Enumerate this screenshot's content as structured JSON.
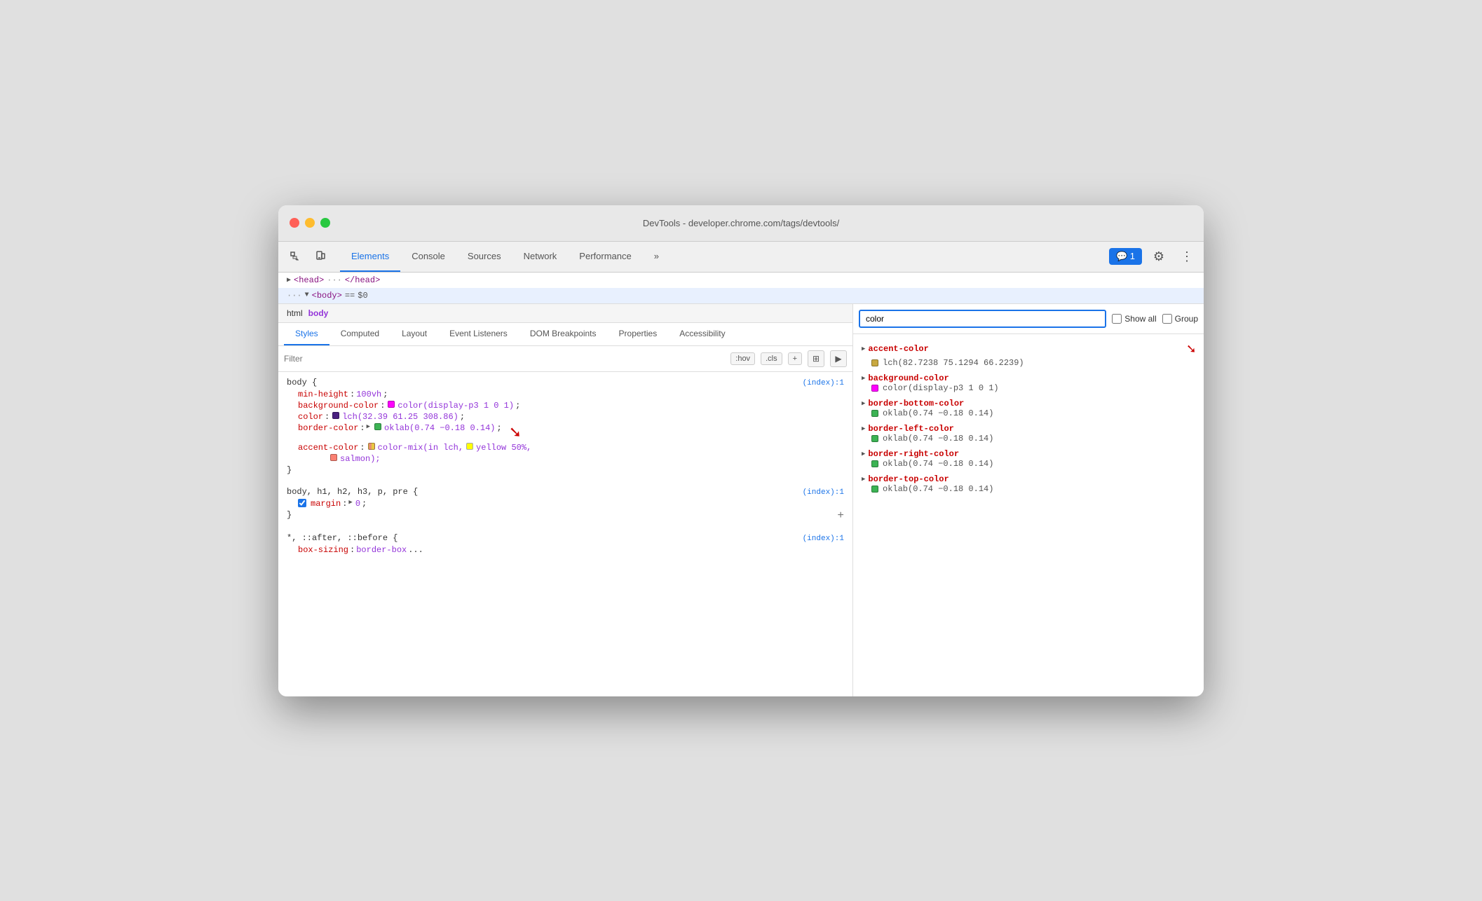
{
  "window": {
    "title": "DevTools - developer.chrome.com/tags/devtools/"
  },
  "toolbar": {
    "tabs": [
      {
        "label": "Elements",
        "active": true
      },
      {
        "label": "Console",
        "active": false
      },
      {
        "label": "Sources",
        "active": false
      },
      {
        "label": "Network",
        "active": false
      },
      {
        "label": "Performance",
        "active": false
      },
      {
        "label": "»",
        "active": false
      }
    ],
    "badge_label": "💬 1",
    "more_icon": "⚙",
    "dots_icon": "⋮"
  },
  "dom": {
    "line1": "▶ <head> ··· </head>",
    "line2_prefix": "··· ▼ <body>",
    "line2_suffix": "== $0"
  },
  "breadcrumbs": [
    {
      "label": "html",
      "active": false
    },
    {
      "label": "body",
      "active": true
    }
  ],
  "subtabs": [
    {
      "label": "Styles",
      "active": true
    },
    {
      "label": "Computed",
      "active": false
    },
    {
      "label": "Layout",
      "active": false
    },
    {
      "label": "Event Listeners",
      "active": false
    },
    {
      "label": "DOM Breakpoints",
      "active": false
    },
    {
      "label": "Properties",
      "active": false
    },
    {
      "label": "Accessibility",
      "active": false
    }
  ],
  "filter": {
    "placeholder": "Filter",
    "hov_label": ":hov",
    "cls_label": ".cls",
    "plus_label": "+",
    "icon1": "⊞",
    "icon2": "▶"
  },
  "css_rules": [
    {
      "selector": "body {",
      "source": "(index):1",
      "properties": [
        {
          "prop": "min-height",
          "colon": ":",
          "value": " 100vh",
          "semicolon": ";",
          "swatch": null,
          "checkbox": false,
          "triangle": false
        },
        {
          "prop": "background-color",
          "colon": ":",
          "value": " color(display-p3 1 0 1)",
          "semicolon": ";",
          "swatch": "#ff00ff",
          "checkbox": false,
          "triangle": false
        },
        {
          "prop": "color",
          "colon": ":",
          "value": " lch(32.39 61.25 308.86)",
          "semicolon": ";",
          "swatch": "#4a2080",
          "checkbox": false,
          "triangle": false
        },
        {
          "prop": "border-color",
          "colon": ":",
          "value": " oklab(0.74 −0.18 0.14)",
          "semicolon": ";",
          "swatch": "#3cb354",
          "checkbox": false,
          "triangle": true
        },
        {
          "prop": "accent-color",
          "colon": ":",
          "value": " color-mix(in lch, ",
          "value2": "yellow",
          "value3": " 50%,",
          "semicolon": "",
          "swatch": "#e8c840",
          "swatch2": "#e89070",
          "checkbox": false,
          "triangle": false
        }
      ],
      "salmon_line": "    salmon);"
    },
    {
      "selector": "body, h1, h2, h3, p, pre {",
      "source": "(index):1",
      "properties": [
        {
          "prop": "margin",
          "colon": ":",
          "value": " 0",
          "semicolon": ";",
          "swatch": null,
          "checkbox": true,
          "triangle": true
        }
      ]
    },
    {
      "selector": "*, ::after, ::before {",
      "source": "(index):1",
      "properties": [
        {
          "prop": "box-sizing",
          "colon": ":",
          "value": " border-box",
          "semicolon": ";",
          "swatch": null,
          "checkbox": false,
          "triangle": false
        }
      ]
    }
  ],
  "right_panel": {
    "search_placeholder": "color",
    "show_all_label": "Show all",
    "group_label": "Group",
    "computed_props": [
      {
        "name": "accent-color",
        "swatch": "#c8a840",
        "value": "lch(82.7238 75.1294 66.2239)",
        "has_arrow": true
      },
      {
        "name": "background-color",
        "swatch": "#ff00ff",
        "value": "color(display-p3 1 0 1)",
        "has_arrow": false
      },
      {
        "name": "border-bottom-color",
        "swatch": "#3cb354",
        "value": "oklab(0.74 −0.18 0.14)",
        "has_arrow": false
      },
      {
        "name": "border-left-color",
        "swatch": "#3cb354",
        "value": "oklab(0.74 −0.18 0.14)",
        "has_arrow": false
      },
      {
        "name": "border-right-color",
        "swatch": "#3cb354",
        "value": "oklab(0.74 −0.18 0.14)",
        "has_arrow": false
      },
      {
        "name": "border-top-color",
        "swatch": "#3cb354",
        "value": "oklab(0.74 −0.18 0.14)",
        "has_arrow": false
      }
    ]
  },
  "colors": {
    "accent": "#1a73e8",
    "active_tab_border": "#1a73e8",
    "prop_color": "#c80000",
    "value_color": "#9334d9",
    "selector_purple": "#881280",
    "source_link": "#1a73e8"
  }
}
